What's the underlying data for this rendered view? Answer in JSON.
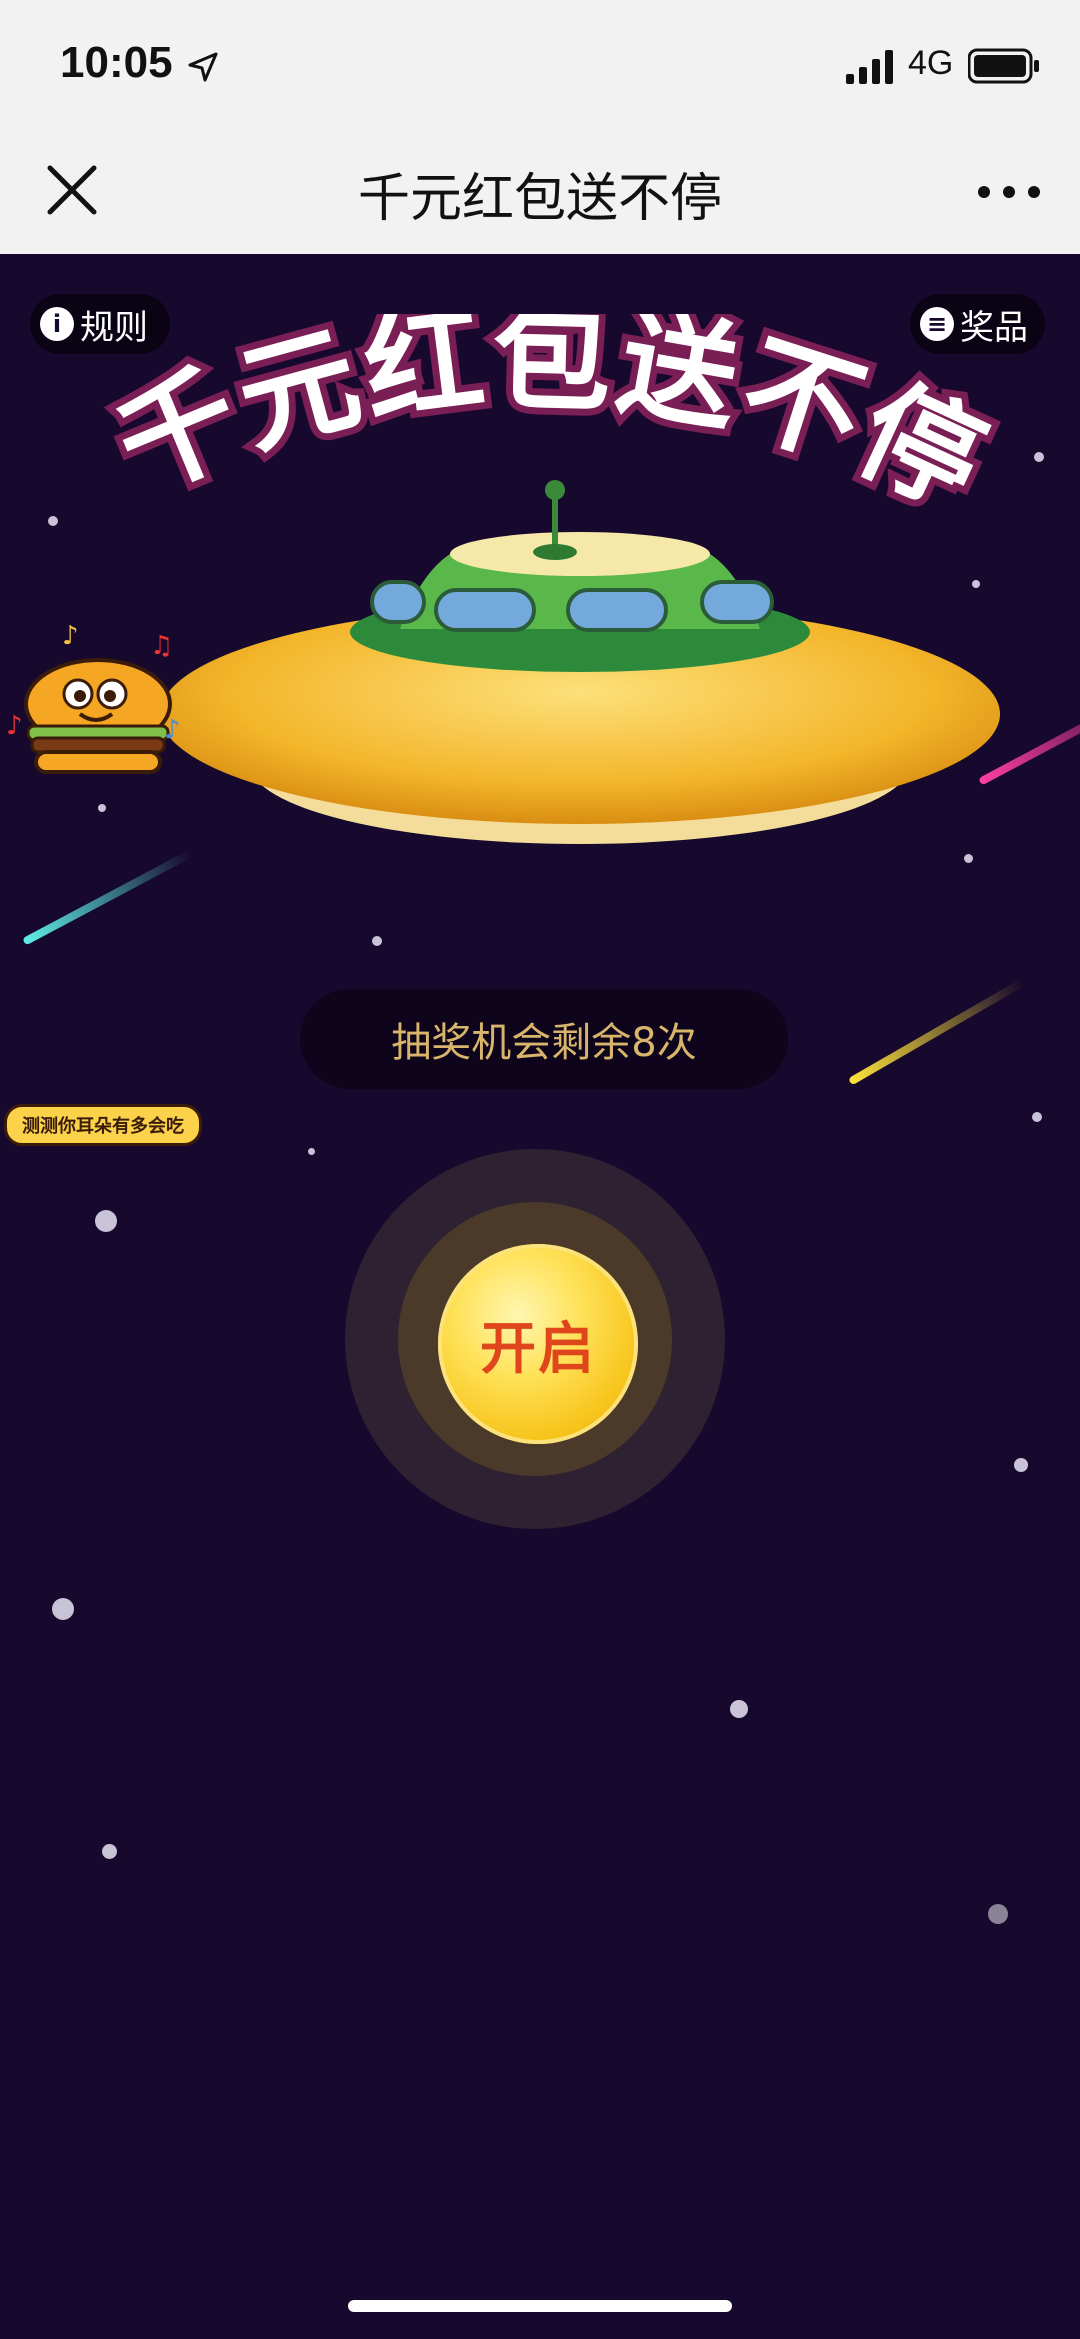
{
  "status_bar": {
    "time": "10:05",
    "network": "4G"
  },
  "nav": {
    "title": "千元红包送不停"
  },
  "page": {
    "rules_label": "规则",
    "prizes_label": "奖品",
    "banner_title": "千元红包送不停",
    "promo_label": "测测你耳朵有多会吃",
    "chances_text": "抽奖机会剩余8次",
    "open_button_label": "开启"
  },
  "colors": {
    "background": "#17082e",
    "banner_white": "#ffffff",
    "banner_yellow": "#fbd24a",
    "coin": "#ffe25a",
    "coin_text": "#e0461c",
    "chance_text": "#d8b56a"
  }
}
